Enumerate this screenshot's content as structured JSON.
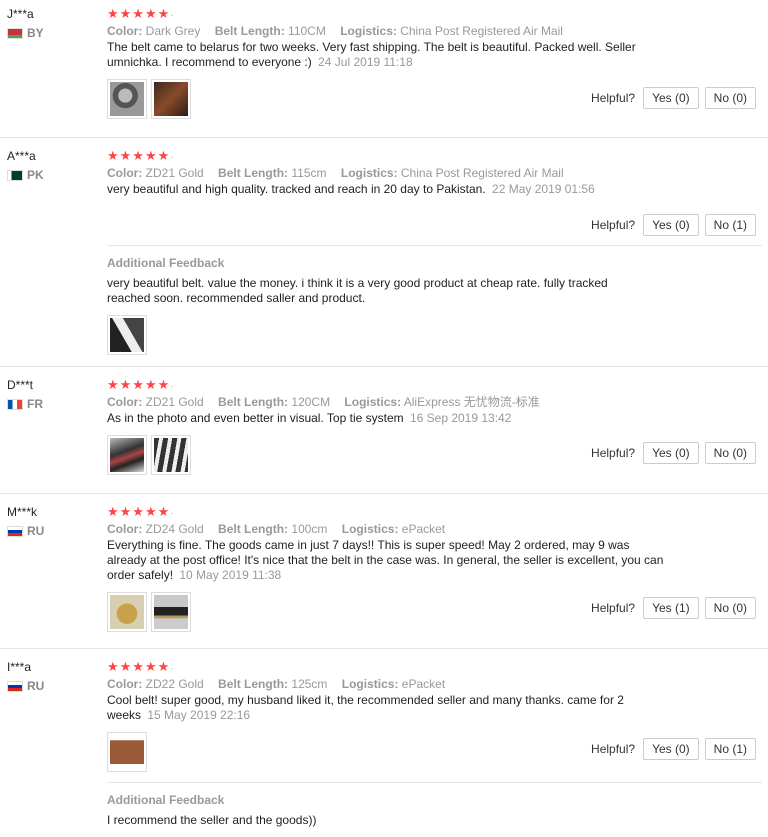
{
  "labels": {
    "color": "Color:",
    "belt_length": "Belt Length:",
    "logistics": "Logistics:",
    "helpful": "Helpful?",
    "additional_feedback": "Additional Feedback"
  },
  "reviews": [
    {
      "user": "J***a",
      "country": "BY",
      "stars": "★★★★★",
      "color": "Dark Grey",
      "belt_length": "110CM",
      "logistics": "China Post Registered Air Mail",
      "text": "The belt came to belarus for two weeks. Very fast shipping. The belt is beautiful. Packed well. Seller umnichka. I recommend to everyone :)",
      "date": "24 Jul 2019 11:18",
      "yes": "Yes (0)",
      "no": "No (0)"
    },
    {
      "user": "A***a",
      "country": "PK",
      "stars": "★★★★★",
      "color": "ZD21 Gold",
      "belt_length": "115cm",
      "logistics": "China Post Registered Air Mail",
      "text": "very beautiful and high quality. tracked and reach in 20 day to Pakistan.",
      "date": "22 May 2019 01:56",
      "yes": "Yes (0)",
      "no": "No (1)",
      "additional": "very beautiful belt. value the money. i think it is a very good product at cheap rate. fully tracked reached soon. recommended saller and product."
    },
    {
      "user": "D***t",
      "country": "FR",
      "stars": "★★★★★",
      "color": "ZD21 Gold",
      "belt_length": "120CM",
      "logistics": "AliExpress 无忧物流-标准",
      "text": "As in the photo and even better in visual. Top tie system",
      "date": "16 Sep 2019 13:42",
      "yes": "Yes (0)",
      "no": "No (0)"
    },
    {
      "user": "M***k",
      "country": "RU",
      "stars": "★★★★★",
      "color": "ZD24 Gold",
      "belt_length": "100cm",
      "logistics": "ePacket",
      "text": "Everything is fine. The goods came in just 7 days!! This is super speed! May 2 ordered, may 9 was already at the post office! It's nice that the belt in the case was. In general, the seller is excellent, you can order safely!",
      "date": "10 May 2019 11:38",
      "yes": "Yes (1)",
      "no": "No (0)"
    },
    {
      "user": "I***a",
      "country": "RU",
      "stars": "★★★★★",
      "color": "ZD22 Gold",
      "belt_length": "125cm",
      "logistics": "ePacket",
      "text": "Cool belt! super good, my husband liked it, the recommended seller and many thanks. came for 2 weeks",
      "date": "15 May 2019 22:16",
      "yes": "Yes (0)",
      "no": "No (1)",
      "additional": "I recommend the seller and the goods))"
    }
  ]
}
